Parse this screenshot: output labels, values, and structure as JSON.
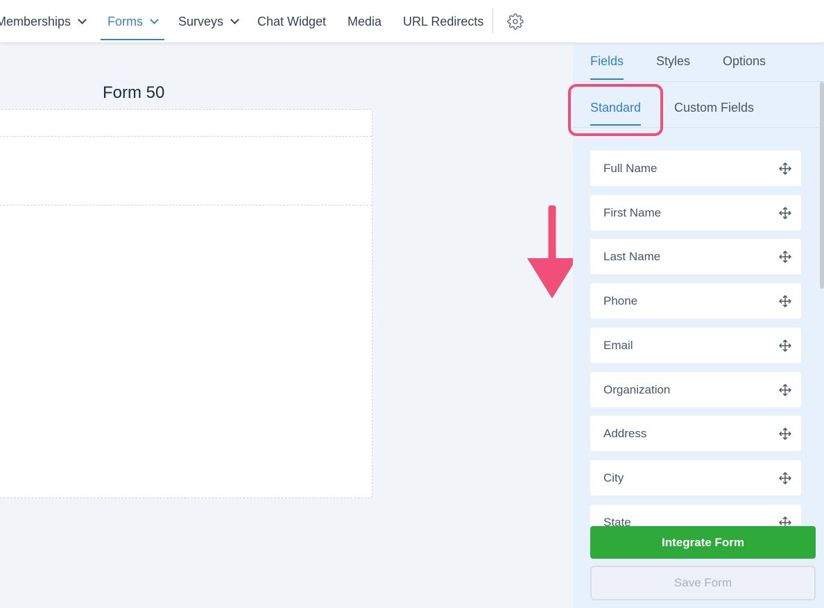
{
  "nav": {
    "items": [
      {
        "label": "Memberships",
        "has_dropdown": true,
        "active": false
      },
      {
        "label": "Forms",
        "has_dropdown": true,
        "active": true
      },
      {
        "label": "Surveys",
        "has_dropdown": true,
        "active": false
      },
      {
        "label": "Chat Widget",
        "has_dropdown": false,
        "active": false
      },
      {
        "label": "Media",
        "has_dropdown": false,
        "active": false
      },
      {
        "label": "URL Redirects",
        "has_dropdown": false,
        "active": false
      }
    ],
    "settings_icon": "gear-icon"
  },
  "form": {
    "title": "Form 50"
  },
  "panel": {
    "tabs": [
      {
        "label": "Fields",
        "active": true
      },
      {
        "label": "Styles",
        "active": false
      },
      {
        "label": "Options",
        "active": false
      }
    ],
    "subtabs": [
      {
        "label": "Standard",
        "active": true
      },
      {
        "label": "Custom Fields",
        "active": false
      }
    ],
    "fields": [
      {
        "label": "Full Name"
      },
      {
        "label": "First Name"
      },
      {
        "label": "Last Name"
      },
      {
        "label": "Phone"
      },
      {
        "label": "Email"
      },
      {
        "label": "Organization"
      },
      {
        "label": "Address"
      },
      {
        "label": "City"
      },
      {
        "label": "State"
      }
    ],
    "integrate_button": "Integrate Form",
    "save_button": "Save Form"
  },
  "colors": {
    "accent": "#2f80cf",
    "highlight": "#ef4f78",
    "integrate": "#2eaa3a",
    "panel_bg": "#e7f1fb"
  }
}
